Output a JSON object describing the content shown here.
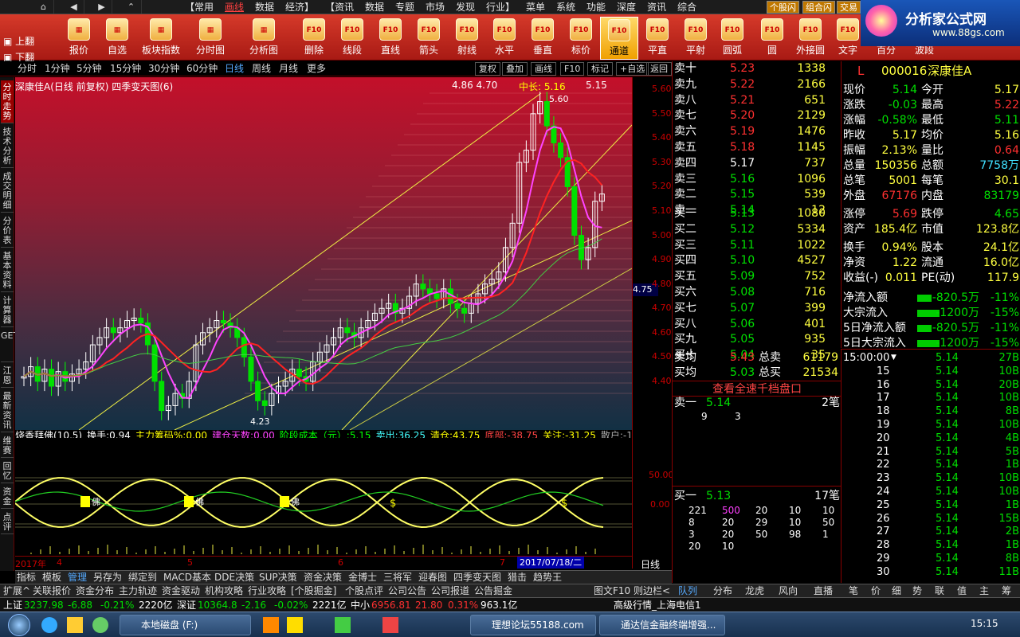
{
  "menubar": {
    "items": [
      "【常用",
      "画线",
      "数据",
      "经济】",
      "【资讯",
      "数据",
      "专题",
      "市场",
      "发现",
      "行业】",
      "菜单",
      "系统",
      "功能",
      "深度",
      "资讯",
      "综合"
    ],
    "right_tabs": [
      "个股闪",
      "组合闪",
      "交易"
    ]
  },
  "logo": {
    "title": "分析家公式网",
    "url": "www.88gs.com"
  },
  "toolbar": {
    "left": [
      "上翻",
      "下翻"
    ],
    "items": [
      "报价",
      "自选",
      "板块指数",
      "分时图",
      "分析图",
      "删除",
      "线段",
      "直线",
      "箭头",
      "射线",
      "水平",
      "垂直",
      "标价",
      "通道",
      "平直",
      "平射",
      "圆弧",
      "圆",
      "外接圆",
      "文字",
      "百分",
      "波段"
    ],
    "selected": "通道"
  },
  "period": {
    "items": [
      "分时",
      "1分钟",
      "5分钟",
      "15分钟",
      "30分钟",
      "60分钟",
      "日线",
      "周线",
      "月线",
      "更多"
    ],
    "selected": "日线",
    "right": [
      "复权",
      "叠加",
      "画线",
      "F10",
      "标记",
      "+自选",
      "返回"
    ]
  },
  "chart": {
    "title": "深康佳A(日线 前复权) 四季变天图(6)",
    "top_values": "4.86  4.70",
    "mid_label": "中长: 5.16",
    "mid_val": "5.15",
    "high_label": "5.60",
    "low_label": "4.23",
    "current_price_tag": "4.75"
  },
  "chart_data": {
    "type": "line",
    "title": "深康佳A(日线 前复权) 四季变天图(6)",
    "yticks": [
      5.6,
      5.5,
      5.4,
      5.3,
      5.2,
      5.1,
      5.0,
      4.9,
      4.8,
      4.7,
      4.6,
      4.5,
      4.4
    ],
    "ylim": [
      4.2,
      5.65
    ],
    "high": 5.6,
    "low": 4.23,
    "close": [
      4.42,
      4.46,
      4.4,
      4.45,
      4.38,
      4.44,
      4.4,
      4.43,
      4.45,
      4.48,
      4.55,
      4.58,
      4.62,
      4.6,
      4.62,
      4.65,
      4.66,
      4.64,
      4.55,
      4.4,
      4.28,
      4.3,
      4.35,
      4.33,
      4.4,
      4.55,
      4.6,
      4.62,
      4.65,
      4.64,
      4.62,
      4.58,
      4.5,
      4.4,
      4.32,
      4.3,
      4.35,
      4.38,
      4.4,
      4.45,
      4.42,
      4.4,
      4.48,
      4.52,
      4.55,
      4.58,
      4.62,
      4.6,
      4.58,
      4.62,
      4.65,
      4.68,
      4.7,
      4.72,
      4.68,
      4.7,
      4.75,
      4.8,
      4.78,
      4.76,
      4.74,
      4.78,
      4.72,
      4.7,
      4.68,
      4.72,
      4.76,
      4.8,
      4.82,
      4.85,
      4.95,
      5.05,
      5.3,
      5.35,
      5.5,
      5.55,
      5.45,
      5.38,
      5.32,
      5.2,
      5.0,
      4.9,
      4.95,
      5.14,
      5.17
    ]
  },
  "indicator": {
    "title": "烧香拜佛(10,5)",
    "items": [
      {
        "label": "换手:",
        "value": "0.94"
      },
      {
        "label": "主力筹码%:",
        "value": "0.00"
      },
      {
        "label": "建仓天数:",
        "value": "0.00"
      },
      {
        "label": "阶段成本（元）:",
        "value": "5.15"
      },
      {
        "label": "卖出:",
        "value": "36.25"
      },
      {
        "label": "清仓:",
        "value": "43.75"
      },
      {
        "label": "底部:",
        "value": "-38.75"
      },
      {
        "label": "关注:",
        "value": "-31.25"
      },
      {
        "label": "散户:",
        "value": "-12"
      }
    ],
    "axis": [
      "50.00",
      "0.00"
    ],
    "markers": [
      "佛",
      "佛",
      "佛",
      "$",
      "$"
    ]
  },
  "timeaxis": {
    "start": "2017年",
    "labels": [
      "4",
      "5",
      "6",
      "7"
    ],
    "cursor_date": "2017/07/18/二",
    "period": "日线"
  },
  "bottabs": [
    "指标",
    "模板",
    "管理",
    "另存为",
    "绑定到",
    "MACD基本",
    "DDE决策",
    "SUP决策",
    "资金决策",
    "金博士",
    "三将军",
    "迎春图",
    "四季变天图",
    "猎击",
    "趋势王"
  ],
  "bottabs_sel": "管理",
  "bottabs2": [
    "扩展^",
    "关联报价",
    "资金分布",
    "主力轨迹",
    "资金驱动",
    "机构攻略",
    "行业攻略",
    "[个股掘金]",
    "个股点评",
    "公司公告",
    "公司报道",
    "公告掘金"
  ],
  "bottabs2_right": "图文F10",
  "bottabs2_right2": "则边栏<",
  "vtabs": [
    "分时走势",
    "技术分析",
    "成交明细",
    "分价表",
    "基本资料",
    "计算器",
    "GET",
    "江恩",
    "最新资讯",
    "维赛",
    "回忆",
    "资金",
    "点评"
  ],
  "orderbook": {
    "asks": [
      [
        "卖十",
        "5.23",
        "1338"
      ],
      [
        "卖九",
        "5.22",
        "2166"
      ],
      [
        "卖八",
        "5.21",
        "651"
      ],
      [
        "卖七",
        "5.20",
        "2129"
      ],
      [
        "卖六",
        "5.19",
        "1476"
      ],
      [
        "卖五",
        "5.18",
        "1145"
      ],
      [
        "卖四",
        "5.17",
        "737"
      ],
      [
        "卖三",
        "5.16",
        "1096"
      ],
      [
        "卖二",
        "5.15",
        "539"
      ],
      [
        "卖一",
        "5.14",
        "12"
      ]
    ],
    "bids": [
      [
        "买一",
        "5.13",
        "1080"
      ],
      [
        "买二",
        "5.12",
        "5334"
      ],
      [
        "买三",
        "5.11",
        "1022"
      ],
      [
        "买四",
        "5.10",
        "4527"
      ],
      [
        "买五",
        "5.09",
        "752"
      ],
      [
        "买六",
        "5.08",
        "716"
      ],
      [
        "买七",
        "5.07",
        "399"
      ],
      [
        "买八",
        "5.06",
        "401"
      ],
      [
        "买九",
        "5.05",
        "935"
      ],
      [
        "买十",
        "5.04",
        "35"
      ]
    ],
    "avg": [
      [
        "卖均",
        "5.43",
        "总卖",
        "61179"
      ],
      [
        "买均",
        "5.03",
        "总买",
        "21534"
      ]
    ],
    "full_link": "查看全速千档盘口",
    "ask1": {
      "label": "卖一",
      "price": "5.14",
      "count": "2笔",
      "orders": [
        "9",
        "3"
      ]
    },
    "bid1": {
      "label": "买一",
      "price": "5.13",
      "count": "17笔",
      "orders": [
        [
          "221",
          "500",
          "20",
          "10",
          "10"
        ],
        [
          "8",
          "20",
          "29",
          "10",
          "50"
        ],
        [
          "3",
          "20",
          "50",
          "98",
          "1"
        ],
        [
          "20",
          "10",
          "",
          "",
          ""
        ]
      ]
    }
  },
  "quote": {
    "code": "000016",
    "name": "深康佳A",
    "flag": "L",
    "rows": [
      [
        "现价",
        "5.14",
        "今开",
        "5.17"
      ],
      [
        "涨跌",
        "-0.03",
        "最高",
        "5.22"
      ],
      [
        "涨幅",
        "-0.58%",
        "最低",
        "5.11"
      ],
      [
        "昨收",
        "5.17",
        "均价",
        "5.16"
      ],
      [
        "振幅",
        "2.13%",
        "量比",
        "0.64"
      ],
      [
        "总量",
        "150356",
        "总额",
        "7758万"
      ],
      [
        "总笔",
        "5001",
        "每笔",
        "30.1"
      ],
      [
        "外盘",
        "67176",
        "内盘",
        "83179"
      ],
      [
        "涨停",
        "5.69",
        "跌停",
        "4.65"
      ],
      [
        "资产",
        "185.4亿",
        "市值",
        "123.8亿"
      ],
      [
        "换手",
        "0.94%",
        "股本",
        "24.1亿"
      ],
      [
        "净资",
        "1.22",
        "流通",
        "16.0亿"
      ],
      [
        "收益(-)",
        "0.011",
        "PE(动)",
        "117.9"
      ]
    ],
    "flows": [
      [
        "净流入额",
        "-820.5万",
        "-11%"
      ],
      [
        "大宗流入",
        "-1200万",
        "-15%"
      ],
      [
        "5日净流入额",
        "-820.5万",
        "-11%"
      ],
      [
        "5日大宗流入",
        "-1200万",
        "-15%"
      ]
    ]
  },
  "ticks": {
    "header": "15:00:00",
    "rows": [
      [
        "",
        "5.14",
        "27B"
      ],
      [
        "15",
        "5.14",
        "10B"
      ],
      [
        "16",
        "5.14",
        "20B"
      ],
      [
        "17",
        "5.14",
        "10B"
      ],
      [
        "18",
        "5.14",
        "8B"
      ],
      [
        "19",
        "5.14",
        "10B"
      ],
      [
        "20",
        "5.14",
        "4B"
      ],
      [
        "21",
        "5.14",
        "5B"
      ],
      [
        "22",
        "5.14",
        "1B"
      ],
      [
        "23",
        "5.14",
        "10B"
      ],
      [
        "24",
        "5.14",
        "10B"
      ],
      [
        "25",
        "5.14",
        "1B"
      ],
      [
        "26",
        "5.14",
        "15B"
      ],
      [
        "27",
        "5.14",
        "2B"
      ],
      [
        "28",
        "5.14",
        "1B"
      ],
      [
        "29",
        "5.14",
        "8B"
      ],
      [
        "30",
        "5.14",
        "11B"
      ]
    ]
  },
  "rtabs": [
    "队列",
    "分布",
    "龙虎",
    "风向",
    "直播",
    "笔",
    "价",
    "细",
    "势",
    "联",
    "值",
    "主",
    "筹"
  ],
  "rtabs_sel": "队列",
  "indexbar": [
    {
      "name": "上证",
      "val": "3237.98",
      "chg": "-6.88",
      "pct": "-0.21%",
      "amt": "2220亿"
    },
    {
      "name": "深证",
      "val": "10364.8",
      "chg": "-2.16",
      "pct": "-0.02%",
      "amt": "2221亿"
    },
    {
      "name": "中小",
      "val": "6956.81",
      "chg": "21.80",
      "pct": "0.31%",
      "amt": "963.1亿"
    }
  ],
  "indexbar_status": "高级行情_上海电信1",
  "taskbar": {
    "items": [
      "本地磁盘 (F:)",
      "理想论坛55188.com",
      "通达信金融终端增强..."
    ],
    "clock": "15:15"
  }
}
